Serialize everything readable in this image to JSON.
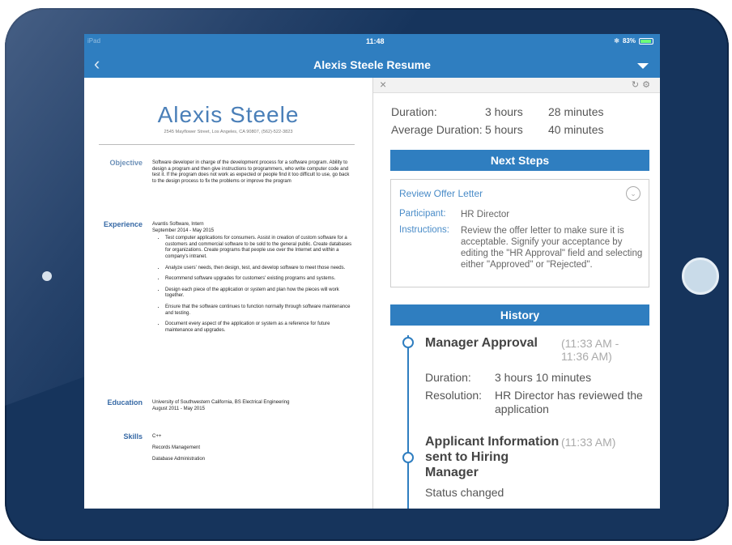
{
  "status_bar": {
    "carrier": "iPad",
    "time": "11:48",
    "battery": "83%"
  },
  "nav": {
    "title": "Alexis Steele Resume"
  },
  "resume": {
    "name": "Alexis Steele",
    "address": "2545 Mayflower Street, Los Angeles, CA 90807, (562)-522-3823",
    "objective_label": "Objective",
    "objective_text": "Software developer in charge of the development process for a software program. Ability to design a program and then give instructions to programmers, who write computer code and test it. If the program does not work as expected or people find it too difficult to use, go back to the design process to fix the problems or improve the program",
    "experience_label": "Experience",
    "experience_company": "Avantis Software, Intern",
    "experience_dates": "September 2014 - May 2015",
    "experience_bullets": [
      "Test computer applications for consumers. Assist in creation of custom software for a customers and commercial software to be sold to the general public. Create databases for organizations. Create programs that people use over the Internet and within a company's intranet.",
      "Analyze users' needs, then design, test, and develop software to meet those needs.",
      "Recommend software upgrades for customers' existing programs and systems.",
      "Design each piece of the application or system and plan how the pieces will work together.",
      "Ensure that the software continues to function normally through software maintenance and testing.",
      "Document every aspect of the application or system as a reference for future maintenance and upgrades."
    ],
    "education_label": "Education",
    "education_school": "University of Southwestern California, BS Electrical Engineering",
    "education_dates": "August 2011 - May 2015",
    "skills_label": "Skills",
    "skills": [
      "C++",
      "Records Management",
      "Database Administration"
    ]
  },
  "workflow": {
    "duration_label": "Duration:",
    "duration_h": "3 hours",
    "duration_m": "28 minutes",
    "avg_label": "Average Duration:",
    "avg_h": "5 hours",
    "avg_m": "40 minutes",
    "next_steps_header": "Next Steps",
    "step": {
      "title": "Review Offer Letter",
      "participant_label": "Participant:",
      "participant": "HR Director",
      "instructions_label": "Instructions:",
      "instructions": "Review the offer letter to make sure it is acceptable. Signify your acceptance by editing the \"HR Approval\" field and selecting either \"Approved\" or \"Rejected\"."
    },
    "history_header": "History",
    "history": [
      {
        "title": "Manager Approval",
        "time": "(11:33 AM - 11:36 AM)",
        "duration_label": "Duration:",
        "duration": "3 hours 10 minutes",
        "resolution_label": "Resolution:",
        "resolution": "HR Director has reviewed the application"
      },
      {
        "title": "Applicant Information sent to Hiring Manager",
        "time": "(11:33 AM)",
        "status": "Status changed"
      }
    ]
  }
}
